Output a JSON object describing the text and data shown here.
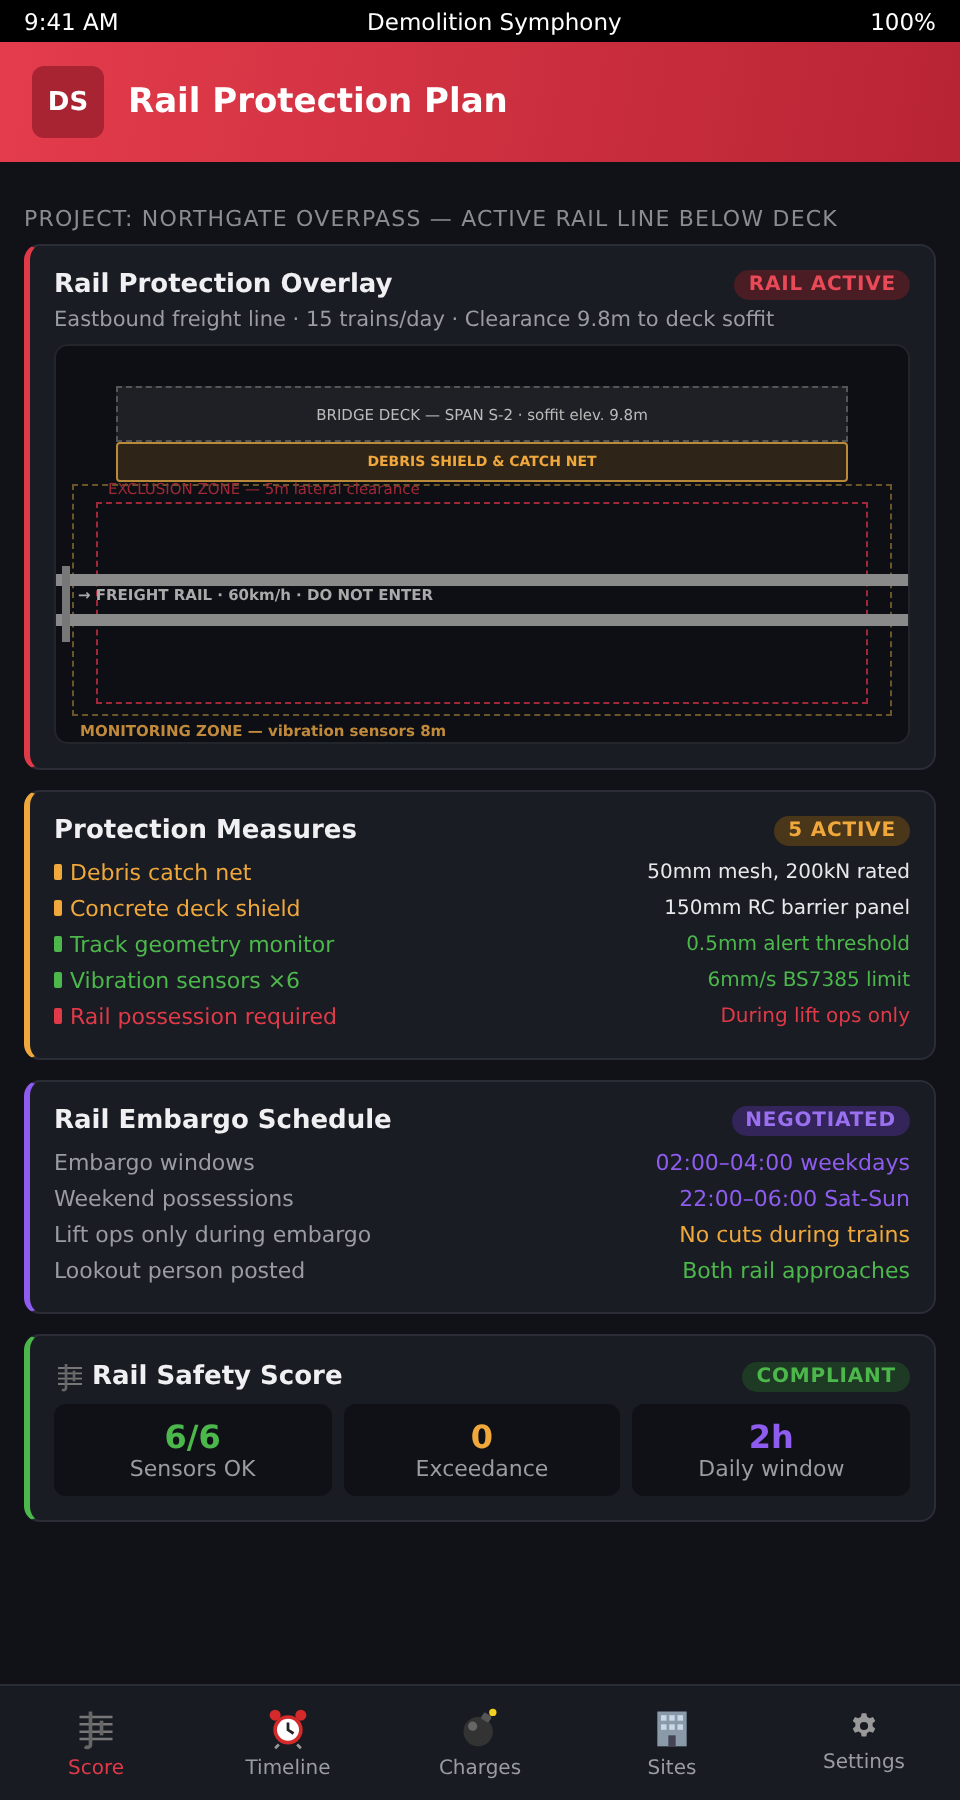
{
  "status_bar": {
    "time": "9:41 AM",
    "title": "Demolition Symphony",
    "battery": "100%"
  },
  "header": {
    "logo": "DS",
    "title": "Rail Protection Plan"
  },
  "project": "PROJECT: NORTHGATE OVERPASS — ACTIVE RAIL LINE BELOW DECK",
  "overlay": {
    "title": "Rail Protection Overlay",
    "badge": "RAIL ACTIVE",
    "subtitle": "Eastbound freight line · 15 trains/day · Clearance 9.8m to deck soffit",
    "deck": "BRIDGE DECK — SPAN S-2 · soffit elev. 9.8m",
    "shield": "DEBRIS SHIELD & CATCH NET",
    "exclusion": "EXCLUSION ZONE — 5m lateral clearance",
    "rail": "→ FREIGHT RAIL · 60km/h · DO NOT ENTER",
    "monitoring": "MONITORING ZONE — vibration sensors 8m"
  },
  "measures": {
    "title": "Protection Measures",
    "badge": "5 ACTIVE",
    "items": [
      {
        "kind": "spec",
        "label": "Debris catch net",
        "value": "50mm mesh, 200kN rated",
        "color": "#f0a83c"
      },
      {
        "kind": "spec",
        "label": "Concrete deck shield",
        "value": "150mm RC barrier panel",
        "color": "#f0a83c"
      },
      {
        "kind": "status",
        "label": "Track geometry monitor",
        "value": "0.5mm alert threshold",
        "color": "#4cb84c"
      },
      {
        "kind": "status",
        "label": "Vibration sensors ×6",
        "value": "6mm/s BS7385 limit",
        "color": "#4cb84c"
      },
      {
        "kind": "status",
        "label": "Rail possession required",
        "value": "During lift ops only",
        "color": "#e03a48"
      }
    ]
  },
  "embargo": {
    "title": "Rail Embargo Schedule",
    "badge": "NEGOTIATED",
    "rows": [
      {
        "label": "Embargo windows",
        "value": "02:00–04:00 weekdays",
        "color": "#8f5cf0"
      },
      {
        "label": "Weekend possessions",
        "value": "22:00–06:00 Sat-Sun",
        "color": "#8f5cf0"
      },
      {
        "label": "Lift ops only during embargo",
        "value": "No cuts during trains",
        "color": "#f0a83c"
      },
      {
        "label": "Lookout person posted",
        "value": "Both rail approaches",
        "color": "#4cb84c"
      }
    ]
  },
  "safety": {
    "title": "Rail Safety Score",
    "badge": "COMPLIANT",
    "stats": [
      {
        "value": "6/6",
        "label": "Sensors OK",
        "color": "#4cb84c"
      },
      {
        "value": "0",
        "label": "Exceedance",
        "color": "#f0a83c"
      },
      {
        "value": "2h",
        "label": "Daily window",
        "color": "#8f5cf0"
      }
    ]
  },
  "tabs": [
    {
      "label": "Score",
      "selected": true
    },
    {
      "label": "Timeline",
      "selected": false
    },
    {
      "label": "Charges",
      "selected": false
    },
    {
      "label": "Sites",
      "selected": false
    },
    {
      "label": "Settings",
      "selected": false
    }
  ]
}
